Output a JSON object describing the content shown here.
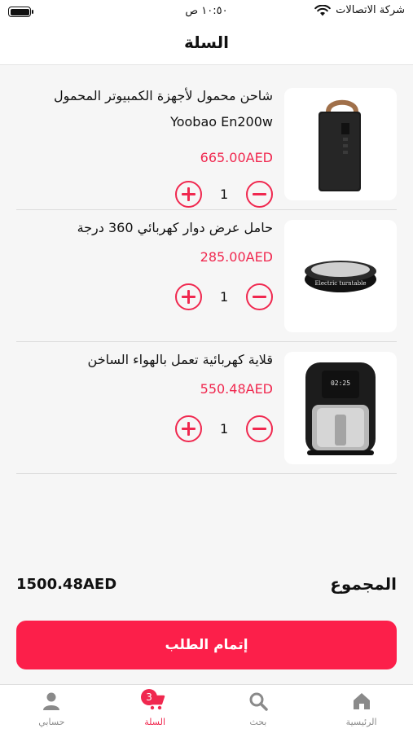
{
  "status_bar": {
    "carrier": "شركة الاتصالات",
    "time": "١٠:٥٠ ص"
  },
  "header": {
    "title": "السلة"
  },
  "cart": {
    "items": [
      {
        "name": "شاحن محمول لأجهزة الكمبيوتر المحمول Yoobao En200w",
        "price": "665.00AED",
        "quantity": "1",
        "image_icon": "power-bank-image"
      },
      {
        "name": "حامل عرض دوار كهربائي 360 درجة",
        "price": "285.00AED",
        "quantity": "1",
        "image_icon": "turntable-image",
        "image_text": "Electric turntable"
      },
      {
        "name": "قلاية كهربائية تعمل بالهواء الساخن",
        "price": "550.48AED",
        "quantity": "1",
        "image_icon": "air-fryer-image",
        "image_text": "02:25"
      }
    ]
  },
  "summary": {
    "total_label": "المجموع",
    "total_amount": "1500.48AED"
  },
  "checkout": {
    "label": "إتمام الطلب"
  },
  "tabs": [
    {
      "label": "الرئيسية",
      "icon": "home-icon",
      "active": false
    },
    {
      "label": "بحث",
      "icon": "search-icon",
      "active": false
    },
    {
      "label": "السلة",
      "icon": "cart-icon",
      "active": true,
      "badge": "3"
    },
    {
      "label": "حسابي",
      "icon": "user-icon",
      "active": false
    }
  ],
  "colors": {
    "accent": "#f0284f",
    "checkout_button": "#fc1f4a",
    "background": "#f6f6f6"
  }
}
